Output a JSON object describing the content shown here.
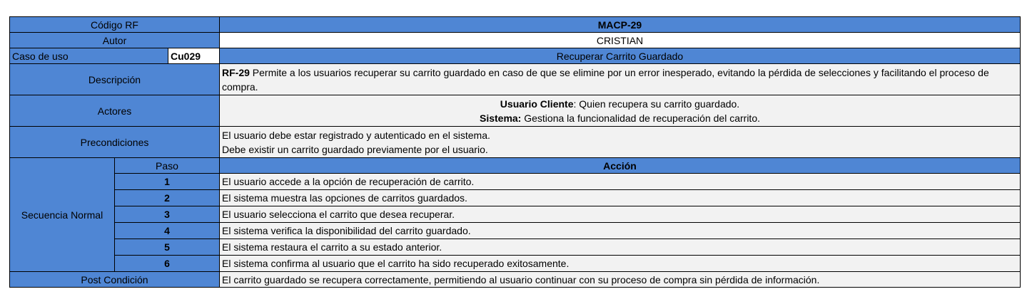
{
  "codigo": {
    "label": "Código RF",
    "value": "MACP-29"
  },
  "autor": {
    "label": "Autor",
    "value": "CRISTIAN"
  },
  "caso": {
    "label": "Caso de uso",
    "code": "Cu029",
    "name": "Recuperar Carrito Guardado"
  },
  "descripcion": {
    "label": "Descripción",
    "ref": "RF-29",
    "text": " Permite a los usuarios recuperar su carrito guardado en caso de que se elimine por un error inesperado, evitando la pérdida de selecciones y facilitando el proceso de compra."
  },
  "actores": {
    "label": "Actores",
    "a1_name": "Usuario Cliente",
    "a1_text": ": Quien recupera su carrito guardado.",
    "a2_name": "Sistema:",
    "a2_text": " Gestiona la funcionalidad de recuperación del carrito."
  },
  "precondiciones": {
    "label": "Precondiciones",
    "line1": "El usuario debe estar registrado y autenticado en el sistema.",
    "line2": "Debe existir un carrito guardado previamente por el usuario."
  },
  "secuencia": {
    "label": "Secuencia Normal",
    "paso_header": "Paso",
    "accion_header": "Acción",
    "steps": [
      {
        "n": "1",
        "action": "El usuario accede a la opción de recuperación de carrito."
      },
      {
        "n": "2",
        "action": "El sistema muestra las opciones de carritos guardados."
      },
      {
        "n": "3",
        "action": "El usuario selecciona el carrito que desea recuperar."
      },
      {
        "n": "4",
        "action": "El sistema verifica la disponibilidad del carrito guardado."
      },
      {
        "n": "5",
        "action": "El sistema restaura el carrito a su estado anterior."
      },
      {
        "n": "6",
        "action": "El sistema confirma al usuario que el carrito ha sido recuperado exitosamente."
      }
    ]
  },
  "post": {
    "label": "Post Condición",
    "text": "El carrito guardado se recupera correctamente, permitiendo al usuario continuar con su proceso de compra sin pérdida de información."
  }
}
